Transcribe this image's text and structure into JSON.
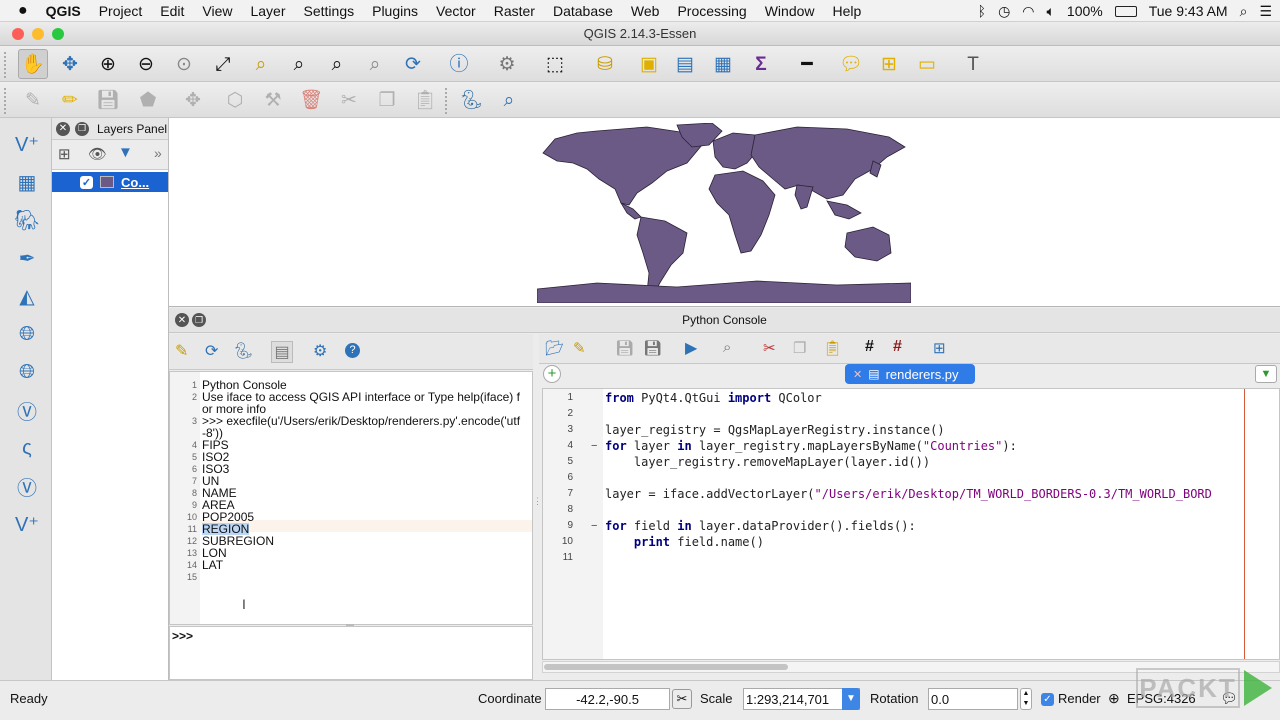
{
  "menubar": {
    "app": "QGIS",
    "items": [
      "Project",
      "Edit",
      "View",
      "Layer",
      "Settings",
      "Plugins",
      "Vector",
      "Raster",
      "Database",
      "Web",
      "Processing",
      "Window",
      "Help"
    ],
    "battery": "100%",
    "clock": "Tue 9:43 AM"
  },
  "window": {
    "title": "QGIS 2.14.3-Essen"
  },
  "layers_panel": {
    "title": "Layers Panel",
    "layer_name": "Co..."
  },
  "console": {
    "title": "Python Console",
    "prompt": ">>>",
    "output": [
      {
        "n": "1",
        "text": "Python Console"
      },
      {
        "n": "2",
        "text": "Use iface to access QGIS API interface or Type help(iface) f"
      },
      {
        "n": "",
        "text": "or more info"
      },
      {
        "n": "3",
        "text": ">>> execfile(u'/Users/erik/Desktop/renderers.py'.encode('utf"
      },
      {
        "n": "",
        "text": "-8'))"
      },
      {
        "n": "4",
        "text": "FIPS"
      },
      {
        "n": "5",
        "text": "ISO2"
      },
      {
        "n": "6",
        "text": "ISO3"
      },
      {
        "n": "7",
        "text": "UN"
      },
      {
        "n": "8",
        "text": "NAME"
      },
      {
        "n": "9",
        "text": "AREA"
      },
      {
        "n": "10",
        "text": "POP2005"
      },
      {
        "n": "11",
        "text": "REGION"
      },
      {
        "n": "12",
        "text": "SUBREGION"
      },
      {
        "n": "13",
        "text": "LON"
      },
      {
        "n": "14",
        "text": "LAT"
      },
      {
        "n": "15",
        "text": ""
      }
    ]
  },
  "editor": {
    "tab": "renderers.py",
    "lines": [
      {
        "n": "1",
        "code": "from PyQt4.QtGui import QColor"
      },
      {
        "n": "2",
        "code": ""
      },
      {
        "n": "3",
        "code": "layer_registry = QgsMapLayerRegistry.instance()"
      },
      {
        "n": "4",
        "code": "for layer in layer_registry.mapLayersByName(\"Countries\"):"
      },
      {
        "n": "5",
        "code": "    layer_registry.removeMapLayer(layer.id())"
      },
      {
        "n": "6",
        "code": ""
      },
      {
        "n": "7",
        "code": "layer = iface.addVectorLayer(\"/Users/erik/Desktop/TM_WORLD_BORDERS-0.3/TM_WORLD_BORD"
      },
      {
        "n": "8",
        "code": ""
      },
      {
        "n": "9",
        "code": "for field in layer.dataProvider().fields():"
      },
      {
        "n": "10",
        "code": "    print field.name()"
      },
      {
        "n": "11",
        "code": ""
      }
    ]
  },
  "status": {
    "ready": "Ready",
    "coordinate_label": "Coordinate",
    "coordinate_value": "-42.2,-90.5",
    "scale_label": "Scale",
    "scale_value": "1:293,214,701",
    "rotation_label": "Rotation",
    "rotation_value": "0.0",
    "render_label": "Render",
    "crs": "EPSG:4326"
  },
  "watermark": "PACKT",
  "colors": {
    "map_fill": "#6b5a86",
    "selection": "#1a63d1",
    "accent": "#2e72b8"
  }
}
